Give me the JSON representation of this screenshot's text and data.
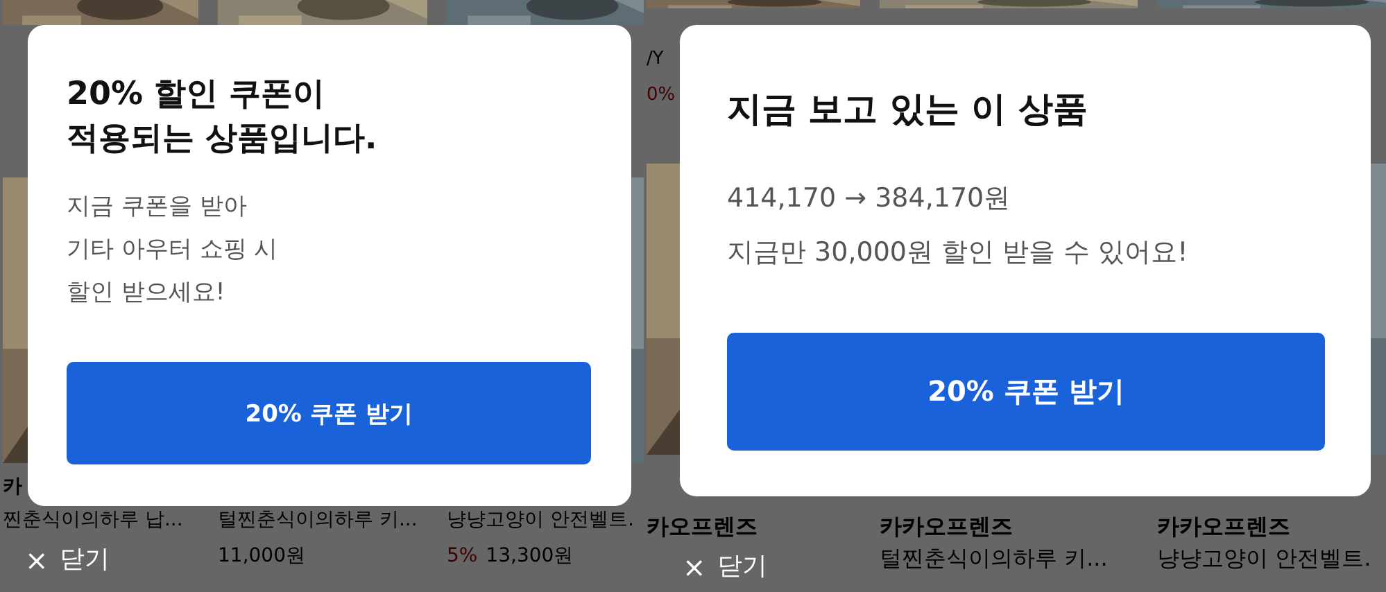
{
  "screens": [
    {
      "background": {
        "products": [
          {
            "brand": "카",
            "name": "찐춘식이의하루 납..."
          },
          {
            "name": "털찐춘식이의하루 키...",
            "price": "11,000원"
          },
          {
            "name": "냥냥고양이 안전벨트.",
            "discount": "5%",
            "price": "13,300원"
          }
        ]
      },
      "dialog": {
        "title": [
          "20% 할인 쿠폰이",
          "적용되는 상품입니다."
        ],
        "body": [
          "지금 쿠폰을 받아",
          "기타 아우터 쇼핑 시",
          "할인 받으세요!"
        ],
        "button": "20% 쿠폰 받기"
      },
      "close": {
        "icon": "×",
        "label": "닫기"
      }
    },
    {
      "background": {
        "products": [
          {
            "top_texts": [
              "/Y"
            ],
            "top_discount": "0%",
            "brand": "카오프렌즈"
          },
          {
            "brand": "카카오프렌즈",
            "name": "털찐춘식이의하루 키..."
          },
          {
            "brand": "카카오프렌즈",
            "name": "냥냥고양이 안전벨트."
          }
        ]
      },
      "dialog": {
        "title": [
          "지금 보고 있는 이 상품"
        ],
        "body": [
          "414,170 → 384,170원",
          "지금만 30,000원 할인 받을 수 있어요!"
        ],
        "button": "20% 쿠폰 받기"
      },
      "close": {
        "icon": "×",
        "label": "닫기"
      }
    }
  ]
}
